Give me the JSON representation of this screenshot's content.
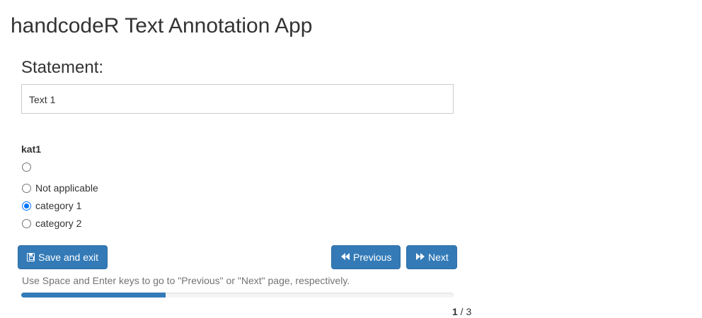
{
  "app": {
    "title": "handcodeR Text Annotation App"
  },
  "statement": {
    "heading": "Statement:",
    "text": "Text 1"
  },
  "question": {
    "label": "kat1",
    "options": [
      {
        "label": "",
        "checked": false
      },
      {
        "label": "Not applicable",
        "checked": false
      },
      {
        "label": "category 1",
        "checked": true
      },
      {
        "label": "category 2",
        "checked": false
      }
    ]
  },
  "buttons": {
    "save_label": "Save and exit",
    "save_icon": "floppy-disk-icon",
    "previous_label": "Previous",
    "previous_icon": "backward-icon",
    "next_label": "Next",
    "next_icon": "forward-icon"
  },
  "help_text": "Use Space and Enter keys to go to \"Previous\" or \"Next\" page, respectively.",
  "progress": {
    "current": "1",
    "separator": " / ",
    "total": "3",
    "fraction": 0.3333
  },
  "colors": {
    "primary": "#337ab7",
    "primary_border": "#2e6da4",
    "radio_checked": "#0075ff",
    "help_text": "#737373"
  }
}
